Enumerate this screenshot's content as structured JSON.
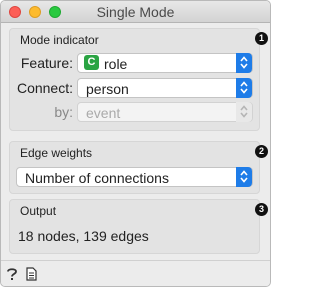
{
  "window": {
    "title": "Single Mode"
  },
  "sections": {
    "mode_indicator": {
      "title": "Mode indicator",
      "badge": "1",
      "feature": {
        "label": "Feature:",
        "value": "role",
        "type_icon": "C"
      },
      "connect": {
        "label": "Connect:",
        "value": "person"
      },
      "by": {
        "label": "by:",
        "value": "event"
      }
    },
    "edge_weights": {
      "title": "Edge weights",
      "badge": "2",
      "value": "Number of connections"
    },
    "output": {
      "title": "Output",
      "badge": "3",
      "summary": "18 nodes, 139 edges"
    }
  },
  "statusbar": {
    "icons": [
      "help-icon",
      "report-icon"
    ]
  },
  "colors": {
    "combo_arrow": "#1e7ce8",
    "categorical_icon": "#2aa443"
  }
}
